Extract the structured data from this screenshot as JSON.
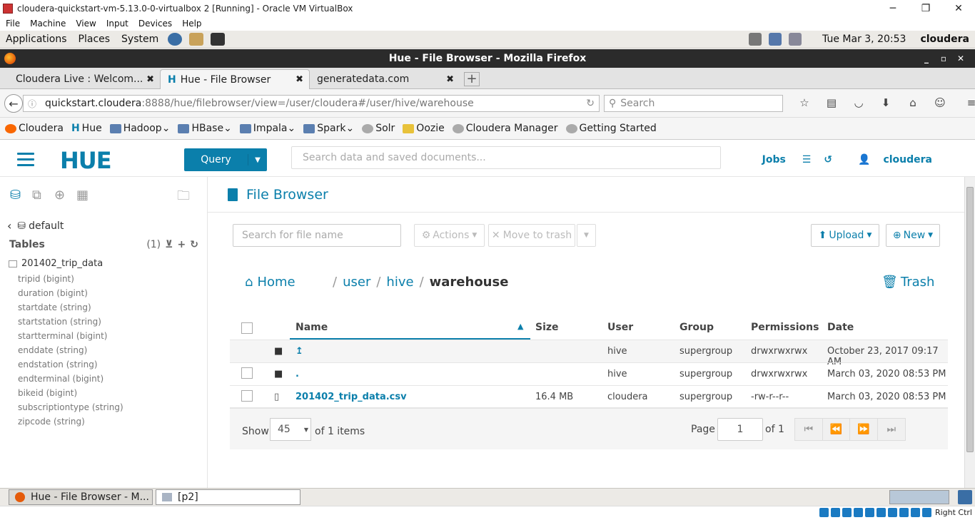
{
  "vbox": {
    "title": "cloudera-quickstart-vm-5.13.0-0-virtualbox 2 [Running] - Oracle VM VirtualBox",
    "menu": [
      "File",
      "Machine",
      "View",
      "Input",
      "Devices",
      "Help"
    ],
    "host_key": "Right Ctrl"
  },
  "gnome": {
    "menu": [
      "Applications",
      "Places",
      "System"
    ],
    "clock": "Tue Mar  3, 20:53",
    "user": "cloudera"
  },
  "firefox": {
    "title": "Hue - File Browser - Mozilla Firefox",
    "tabs": [
      {
        "label": "Cloudera Live : Welcom...",
        "active": false
      },
      {
        "label": "Hue - File Browser",
        "active": true
      },
      {
        "label": "generatedata.com",
        "active": false
      }
    ],
    "url_host": "quickstart.cloudera",
    "url_rest": ":8888/hue/filebrowser/view=/user/cloudera#/user/hive/warehouse",
    "search_placeholder": "Search",
    "bookmarks": [
      "Cloudera",
      "Hue",
      "Hadoop",
      "HBase",
      "Impala",
      "Spark",
      "Solr",
      "Oozie",
      "Cloudera Manager",
      "Getting Started"
    ]
  },
  "hue": {
    "query_label": "Query",
    "search_placeholder": "Search data and saved documents...",
    "jobs_label": "Jobs",
    "user": "cloudera"
  },
  "sidebar": {
    "database": "default",
    "tables_label": "Tables",
    "tables_count": "(1)",
    "table_name": "201402_trip_data",
    "columns": [
      "tripid (bigint)",
      "duration (bigint)",
      "startdate (string)",
      "startstation (string)",
      "startterminal (bigint)",
      "enddate (string)",
      "endstation (string)",
      "endterminal (bigint)",
      "bikeid (bigint)",
      "subscriptiontype (string)",
      "zipcode (string)"
    ]
  },
  "filebrowser": {
    "title": "File Browser",
    "filter_placeholder": "Search for file name",
    "actions_label": "Actions",
    "move_to_trash_label": "Move to trash",
    "upload_label": "Upload",
    "new_label": "New",
    "home_label": "Home",
    "path": [
      "user",
      "hive",
      "warehouse"
    ],
    "trash_label": "Trash",
    "columns": [
      "Name",
      "Size",
      "User",
      "Group",
      "Permissions",
      "Date"
    ],
    "rows": [
      {
        "name": "↥",
        "size": "",
        "user": "hive",
        "group": "supergroup",
        "perm": "drwxrwxrwx",
        "date": "October 23, 2017 09:17 AM",
        "type": "folder"
      },
      {
        "name": ".",
        "size": "",
        "user": "hive",
        "group": "supergroup",
        "perm": "drwxrwxrwx",
        "date": "March 03, 2020 08:53 PM",
        "type": "folder"
      },
      {
        "name": "201402_trip_data.csv",
        "size": "16.4 MB",
        "user": "cloudera",
        "group": "supergroup",
        "perm": "-rw-r--r--",
        "date": "March 03, 2020 08:53 PM",
        "type": "file"
      }
    ],
    "show_label": "Show",
    "page_size": "45",
    "items_label": "of 1 items",
    "page_label": "Page",
    "page_value": "1",
    "page_of": "of 1"
  },
  "taskbar": {
    "items": [
      "Hue - File Browser - M...",
      "[p2]"
    ]
  }
}
